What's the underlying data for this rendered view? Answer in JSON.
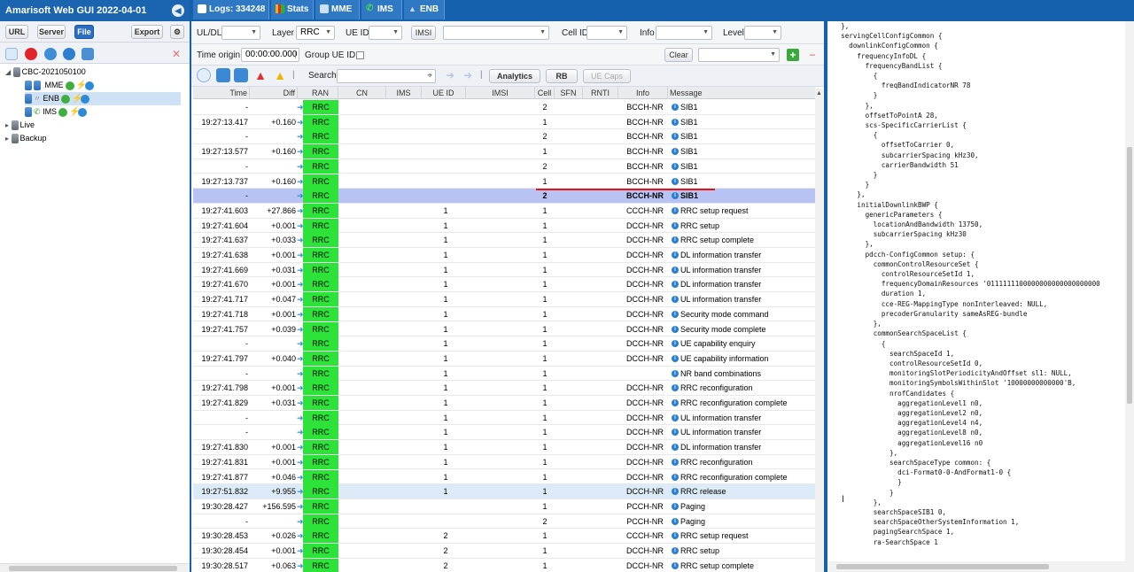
{
  "app": {
    "title": "Amarisoft Web GUI 2022-04-01"
  },
  "tabs": [
    {
      "label": "Logs: 334248",
      "icon": "logs-icon"
    },
    {
      "label": "Stats",
      "icon": "stats-icon"
    },
    {
      "label": "MME",
      "icon": "server-icon"
    },
    {
      "label": "IMS",
      "icon": "phone-icon"
    },
    {
      "label": "ENB",
      "icon": "antenna-icon"
    }
  ],
  "left": {
    "buttons": {
      "url": "URL",
      "server": "Server",
      "file": "File",
      "export": "Export"
    },
    "tree": {
      "root": "CBC-2021050100",
      "children": [
        "MME",
        "ENB",
        "IMS"
      ],
      "live": "Live",
      "backup": "Backup"
    }
  },
  "filters": {
    "uldl_label": "UL/DL",
    "uldl_value": "",
    "layer_label": "Layer",
    "layer_value": "RRC",
    "ueid_label": "UE ID",
    "ueid_value": "",
    "imsi_label": "IMSI",
    "imsi_value": "",
    "cellid_label": "Cell ID",
    "cellid_value": "",
    "info_label": "Info",
    "info_value": "",
    "level_label": "Level",
    "level_value": "",
    "time_origin_label": "Time origin:",
    "time_origin_value": "00:00:00.000",
    "group_ueid_label": "Group UE ID:",
    "clear_label": "Clear",
    "search_label": "Search",
    "analytics_label": "Analytics",
    "rb_label": "RB",
    "uecaps_label": "UE Caps"
  },
  "columns": [
    "Time",
    "Diff",
    "RAN",
    "CN",
    "IMS",
    "UE ID",
    "IMSI",
    "Cell",
    "SFN",
    "RNTI",
    "Info",
    "Message"
  ],
  "rows": [
    {
      "time": "-",
      "diff": "",
      "ran": "RRC",
      "ueid": "",
      "cell": "2",
      "info": "BCCH-NR",
      "msg": "SIB1"
    },
    {
      "time": "19:27:13.417",
      "diff": "+0.160",
      "ran": "RRC",
      "ueid": "",
      "cell": "1",
      "info": "BCCH-NR",
      "msg": "SIB1"
    },
    {
      "time": "-",
      "diff": "",
      "ran": "RRC",
      "ueid": "",
      "cell": "2",
      "info": "BCCH-NR",
      "msg": "SIB1"
    },
    {
      "time": "19:27:13.577",
      "diff": "+0.160",
      "ran": "RRC",
      "ueid": "",
      "cell": "1",
      "info": "BCCH-NR",
      "msg": "SIB1"
    },
    {
      "time": "-",
      "diff": "",
      "ran": "RRC",
      "ueid": "",
      "cell": "2",
      "info": "BCCH-NR",
      "msg": "SIB1"
    },
    {
      "time": "19:27:13.737",
      "diff": "+0.160",
      "ran": "RRC",
      "ueid": "",
      "cell": "1",
      "info": "BCCH-NR",
      "msg": "SIB1"
    },
    {
      "time": "-",
      "diff": "",
      "ran": "RRC",
      "ueid": "",
      "cell": "2",
      "info": "BCCH-NR",
      "msg": "SIB1",
      "selected": true
    },
    {
      "time": "19:27:41.603",
      "diff": "+27.866",
      "ran": "RRC",
      "ueid": "1",
      "cell": "1",
      "info": "CCCH-NR",
      "msg": "RRC setup request"
    },
    {
      "time": "19:27:41.604",
      "diff": "+0.001",
      "ran": "RRC",
      "ueid": "1",
      "cell": "1",
      "info": "DCCH-NR",
      "msg": "RRC setup"
    },
    {
      "time": "19:27:41.637",
      "diff": "+0.033",
      "ran": "RRC",
      "ueid": "1",
      "cell": "1",
      "info": "DCCH-NR",
      "msg": "RRC setup complete"
    },
    {
      "time": "19:27:41.638",
      "diff": "+0.001",
      "ran": "RRC",
      "ueid": "1",
      "cell": "1",
      "info": "DCCH-NR",
      "msg": "DL information transfer"
    },
    {
      "time": "19:27:41.669",
      "diff": "+0.031",
      "ran": "RRC",
      "ueid": "1",
      "cell": "1",
      "info": "DCCH-NR",
      "msg": "UL information transfer"
    },
    {
      "time": "19:27:41.670",
      "diff": "+0.001",
      "ran": "RRC",
      "ueid": "1",
      "cell": "1",
      "info": "DCCH-NR",
      "msg": "DL information transfer"
    },
    {
      "time": "19:27:41.717",
      "diff": "+0.047",
      "ran": "RRC",
      "ueid": "1",
      "cell": "1",
      "info": "DCCH-NR",
      "msg": "UL information transfer"
    },
    {
      "time": "19:27:41.718",
      "diff": "+0.001",
      "ran": "RRC",
      "ueid": "1",
      "cell": "1",
      "info": "DCCH-NR",
      "msg": "Security mode command"
    },
    {
      "time": "19:27:41.757",
      "diff": "+0.039",
      "ran": "RRC",
      "ueid": "1",
      "cell": "1",
      "info": "DCCH-NR",
      "msg": "Security mode complete"
    },
    {
      "time": "-",
      "diff": "",
      "ran": "RRC",
      "ueid": "1",
      "cell": "1",
      "info": "DCCH-NR",
      "msg": "UE capability enquiry"
    },
    {
      "time": "19:27:41.797",
      "diff": "+0.040",
      "ran": "RRC",
      "ueid": "1",
      "cell": "1",
      "info": "DCCH-NR",
      "msg": "UE capability information"
    },
    {
      "time": "-",
      "diff": "",
      "ran": "RRC",
      "ueid": "1",
      "cell": "1",
      "info": "",
      "msg": "NR band combinations"
    },
    {
      "time": "19:27:41.798",
      "diff": "+0.001",
      "ran": "RRC",
      "ueid": "1",
      "cell": "1",
      "info": "DCCH-NR",
      "msg": "RRC reconfiguration"
    },
    {
      "time": "19:27:41.829",
      "diff": "+0.031",
      "ran": "RRC",
      "ueid": "1",
      "cell": "1",
      "info": "DCCH-NR",
      "msg": "RRC reconfiguration complete"
    },
    {
      "time": "-",
      "diff": "",
      "ran": "RRC",
      "ueid": "1",
      "cell": "1",
      "info": "DCCH-NR",
      "msg": "UL information transfer"
    },
    {
      "time": "-",
      "diff": "",
      "ran": "RRC",
      "ueid": "1",
      "cell": "1",
      "info": "DCCH-NR",
      "msg": "UL information transfer"
    },
    {
      "time": "19:27:41.830",
      "diff": "+0.001",
      "ran": "RRC",
      "ueid": "1",
      "cell": "1",
      "info": "DCCH-NR",
      "msg": "DL information transfer"
    },
    {
      "time": "19:27:41.831",
      "diff": "+0.001",
      "ran": "RRC",
      "ueid": "1",
      "cell": "1",
      "info": "DCCH-NR",
      "msg": "RRC reconfiguration"
    },
    {
      "time": "19:27:41.877",
      "diff": "+0.046",
      "ran": "RRC",
      "ueid": "1",
      "cell": "1",
      "info": "DCCH-NR",
      "msg": "RRC reconfiguration complete"
    },
    {
      "time": "19:27:51.832",
      "diff": "+9.955",
      "ran": "RRC",
      "ueid": "1",
      "cell": "1",
      "info": "DCCH-NR",
      "msg": "RRC release",
      "highlight": true
    },
    {
      "time": "19:30:28.427",
      "diff": "+156.595",
      "ran": "RRC",
      "ueid": "",
      "cell": "1",
      "info": "PCCH-NR",
      "msg": "Paging"
    },
    {
      "time": "-",
      "diff": "",
      "ran": "RRC",
      "ueid": "",
      "cell": "2",
      "info": "PCCH-NR",
      "msg": "Paging"
    },
    {
      "time": "19:30:28.453",
      "diff": "+0.026",
      "ran": "RRC",
      "ueid": "2",
      "cell": "1",
      "info": "CCCH-NR",
      "msg": "RRC setup request"
    },
    {
      "time": "19:30:28.454",
      "diff": "+0.001",
      "ran": "RRC",
      "ueid": "2",
      "cell": "1",
      "info": "DCCH-NR",
      "msg": "RRC setup"
    },
    {
      "time": "19:30:28.517",
      "diff": "+0.063",
      "ran": "RRC",
      "ueid": "2",
      "cell": "1",
      "info": "DCCH-NR",
      "msg": "RRC setup complete"
    }
  ],
  "code_lines": [
    "  },",
    "  servingCellConfigCommon {",
    "    downlinkConfigCommon {",
    "      frequencyInfoDL {",
    "        frequencyBandList {",
    "          {",
    "            freqBandIndicatorNR 78",
    "          }",
    "        },",
    "        offsetToPointA 28,",
    "        scs-SpecificCarrierList {",
    "          {",
    "            offsetToCarrier 0,",
    "            subcarrierSpacing kHz30,",
    "            carrierBandwidth 51",
    "          }",
    "        }",
    "      },",
    "      initialDownlinkBWP {",
    "        genericParameters {",
    "          locationAndBandwidth 13750,",
    "          subcarrierSpacing kHz30",
    "        },",
    "        pdcch-ConfigCommon setup: {",
    "          commonControlResourceSet {",
    "            controlResourceSetId 1,",
    "            frequencyDomainResources '0111111100000000000000000000",
    "            duration 1,",
    "            cce-REG-MappingType nonInterleaved: NULL,",
    "            precoderGranularity sameAsREG-bundle",
    "          },",
    "          commonSearchSpaceList {",
    "            {",
    "              searchSpaceId 1,",
    "              controlResourceSetId 0,",
    "              monitoringSlotPeriodicityAndOffset sl1: NULL,",
    "              monitoringSymbolsWithinSlot '10000000000000'B,",
    "              nrofCandidates {",
    "                aggregationLevel1 n0,",
    "                aggregationLevel2 n0,",
    "                aggregationLevel4 n4,",
    "                aggregationLevel8 n0,",
    "                aggregationLevel16 n0",
    "              },",
    "              searchSpaceType common: {",
    "                dci-Format0-0-AndFormat1-0 {",
    "                }",
    "              }",
    "          },",
    "          searchSpaceSIB1 0,",
    "          searchSpaceOtherSystemInformation 1,",
    "          pagingSearchSpace 1,",
    "          ra-SearchSpace 1"
  ]
}
